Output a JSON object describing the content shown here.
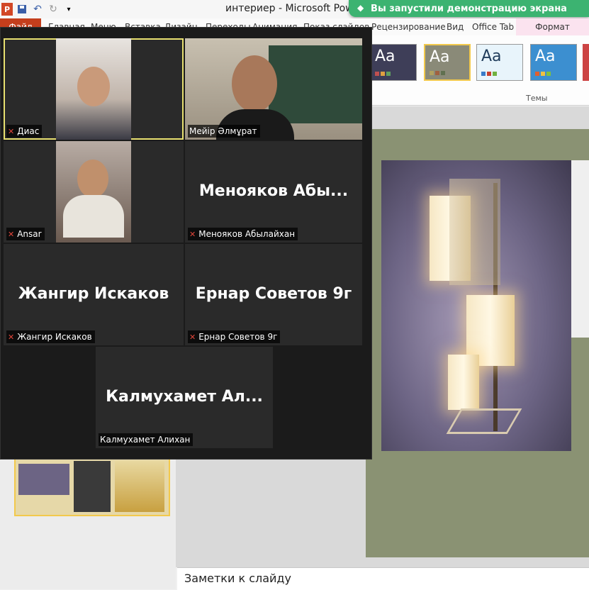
{
  "titlebar": {
    "title": "интериер - Microsoft PowerPoint",
    "app_logo": "P"
  },
  "banner": {
    "text": "Вы запустили демонстрацию экрана",
    "icon": "share-screen-icon"
  },
  "ribbon": {
    "file_tab": "Файл",
    "tabs": [
      "Главная",
      "Меню",
      "Вставка",
      "Дизайн",
      "Переходы",
      "Анимация",
      "Показ слайдов",
      "Рецензирование",
      "Вид",
      "Office Tab"
    ],
    "format_tab": "Формат",
    "theme_sample": "Aa",
    "themes_label": "Темы"
  },
  "participants": [
    {
      "name": "Диас",
      "muted": true,
      "video": true
    },
    {
      "name": "Мейір Әлмұрат",
      "muted": false,
      "video": true
    },
    {
      "name": "Ansar",
      "muted": true,
      "video": true
    },
    {
      "name": "Менояков Абылайхан",
      "display": "Менояков  Абы...",
      "muted": true,
      "video": false
    },
    {
      "name": "Жангир Искаков",
      "display": "Жангир Искаков",
      "muted": true,
      "video": false
    },
    {
      "name": "Ернар Советов 9г",
      "display": "Ернар Советов 9г",
      "muted": true,
      "video": false
    },
    {
      "name": "Калмухамет Алихан",
      "display": "Калмухамет  Ал...",
      "muted": false,
      "video": false
    }
  ],
  "notes": {
    "placeholder": "Заметки к слайду"
  },
  "colors": {
    "banner": "#3cb371",
    "file_tab": "#c43e1c",
    "active_speaker": "#e8e070",
    "mic_muted": "#e0453a"
  }
}
